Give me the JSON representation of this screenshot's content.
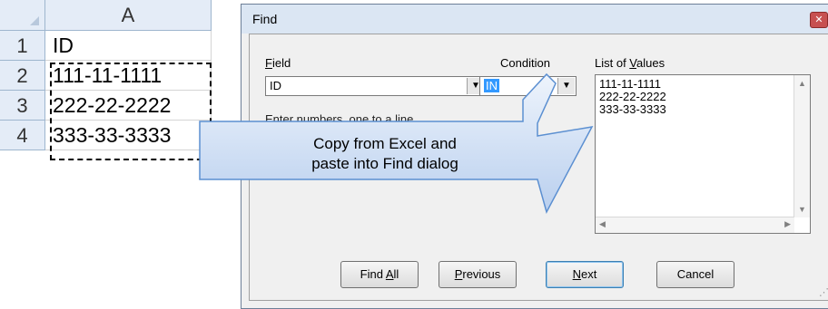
{
  "excel": {
    "column_header": "A",
    "rows": [
      {
        "num": "1",
        "value": "ID"
      },
      {
        "num": "2",
        "value": "111-11-1111"
      },
      {
        "num": "3",
        "value": "222-22-2222"
      },
      {
        "num": "4",
        "value": "333-33-3333"
      }
    ]
  },
  "dialog": {
    "title": "Find",
    "close_glyph": "✕",
    "field_label": "Field",
    "field_value": "ID",
    "condition_label": "Condition",
    "condition_value": "IN",
    "hint_text": "Enter numbers, one to a line",
    "list_label": "List of Values",
    "list_values": [
      "111-11-1111",
      "222-22-2222",
      "333-33-3333"
    ],
    "buttons": {
      "find_all": "Find All",
      "previous": "Previous",
      "next": "Next",
      "cancel": "Cancel"
    }
  },
  "callout": {
    "line1": "Copy from Excel and",
    "line2": "paste into Find dialog",
    "fill_top": "#eef4fc",
    "fill_bottom": "#b9cfee",
    "stroke": "#5b8fd1"
  }
}
